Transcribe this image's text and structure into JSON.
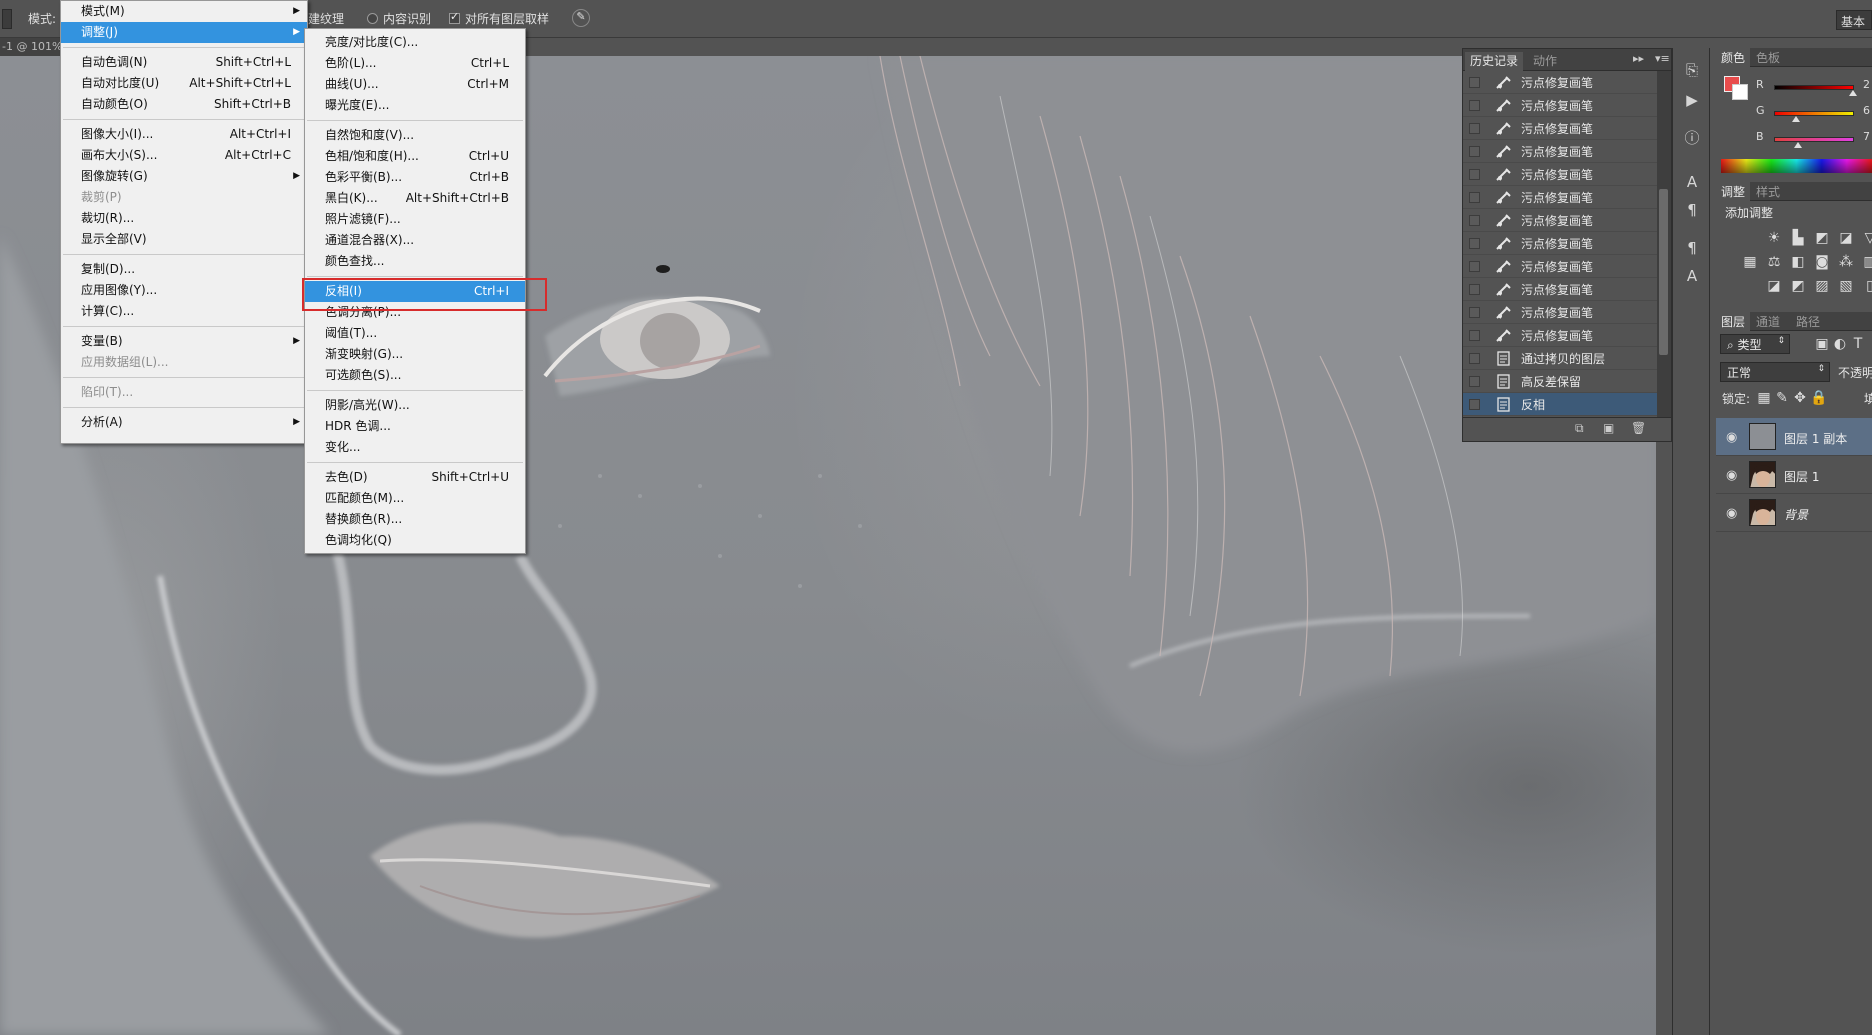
{
  "options_bar": {
    "mode_label": "模式:",
    "option_texture": "建纹理",
    "option_content_aware": "内容识别",
    "option_sample_all": "对所有图层取样",
    "doc_tab_fragment": "-1 @ 101%",
    "workspace_button": "基本"
  },
  "image_menu": {
    "items": [
      {
        "label": "模式(M)",
        "shortcut": "",
        "submenu": true
      },
      {
        "label": "调整(J)",
        "shortcut": "",
        "submenu": true,
        "highlighted": true
      },
      {
        "label": "自动色调(N)",
        "shortcut": "Shift+Ctrl+L"
      },
      {
        "label": "自动对比度(U)",
        "shortcut": "Alt+Shift+Ctrl+L"
      },
      {
        "label": "自动颜色(O)",
        "shortcut": "Shift+Ctrl+B"
      },
      {
        "label": "图像大小(I)...",
        "shortcut": "Alt+Ctrl+I"
      },
      {
        "label": "画布大小(S)...",
        "shortcut": "Alt+Ctrl+C"
      },
      {
        "label": "图像旋转(G)",
        "shortcut": "",
        "submenu": true
      },
      {
        "label": "裁剪(P)",
        "shortcut": "",
        "disabled": true
      },
      {
        "label": "裁切(R)...",
        "shortcut": ""
      },
      {
        "label": "显示全部(V)",
        "shortcut": ""
      },
      {
        "label": "复制(D)...",
        "shortcut": ""
      },
      {
        "label": "应用图像(Y)...",
        "shortcut": ""
      },
      {
        "label": "计算(C)...",
        "shortcut": ""
      },
      {
        "label": "变量(B)",
        "shortcut": "",
        "submenu": true
      },
      {
        "label": "应用数据组(L)...",
        "shortcut": "",
        "disabled": true
      },
      {
        "label": "陷印(T)...",
        "shortcut": "",
        "disabled": true
      },
      {
        "label": "分析(A)",
        "shortcut": "",
        "submenu": true
      }
    ]
  },
  "adjust_menu": {
    "items": [
      {
        "label": "亮度/对比度(C)...",
        "shortcut": ""
      },
      {
        "label": "色阶(L)...",
        "shortcut": "Ctrl+L"
      },
      {
        "label": "曲线(U)...",
        "shortcut": "Ctrl+M"
      },
      {
        "label": "曝光度(E)...",
        "shortcut": ""
      },
      {
        "label": "自然饱和度(V)...",
        "shortcut": ""
      },
      {
        "label": "色相/饱和度(H)...",
        "shortcut": "Ctrl+U"
      },
      {
        "label": "色彩平衡(B)...",
        "shortcut": "Ctrl+B"
      },
      {
        "label": "黑白(K)...",
        "shortcut": "Alt+Shift+Ctrl+B"
      },
      {
        "label": "照片滤镜(F)...",
        "shortcut": ""
      },
      {
        "label": "通道混合器(X)...",
        "shortcut": ""
      },
      {
        "label": "颜色查找...",
        "shortcut": ""
      },
      {
        "label": "反相(I)",
        "shortcut": "Ctrl+I",
        "highlighted": true
      },
      {
        "label": "色调分离(P)...",
        "shortcut": ""
      },
      {
        "label": "阈值(T)...",
        "shortcut": ""
      },
      {
        "label": "渐变映射(G)...",
        "shortcut": ""
      },
      {
        "label": "可选颜色(S)...",
        "shortcut": ""
      },
      {
        "label": "阴影/高光(W)...",
        "shortcut": ""
      },
      {
        "label": "HDR 色调...",
        "shortcut": ""
      },
      {
        "label": "变化...",
        "shortcut": ""
      },
      {
        "label": "去色(D)",
        "shortcut": "Shift+Ctrl+U"
      },
      {
        "label": "匹配颜色(M)...",
        "shortcut": ""
      },
      {
        "label": "替换颜色(R)...",
        "shortcut": ""
      },
      {
        "label": "色调均化(Q)",
        "shortcut": ""
      }
    ]
  },
  "history_panel": {
    "tab_history": "历史记录",
    "tab_actions": "动作",
    "rows": [
      {
        "label": "污点修复画笔",
        "icon": "healing-brush-icon"
      },
      {
        "label": "污点修复画笔",
        "icon": "healing-brush-icon"
      },
      {
        "label": "污点修复画笔",
        "icon": "healing-brush-icon"
      },
      {
        "label": "污点修复画笔",
        "icon": "healing-brush-icon"
      },
      {
        "label": "污点修复画笔",
        "icon": "healing-brush-icon"
      },
      {
        "label": "污点修复画笔",
        "icon": "healing-brush-icon"
      },
      {
        "label": "污点修复画笔",
        "icon": "healing-brush-icon"
      },
      {
        "label": "污点修复画笔",
        "icon": "healing-brush-icon"
      },
      {
        "label": "污点修复画笔",
        "icon": "healing-brush-icon"
      },
      {
        "label": "污点修复画笔",
        "icon": "healing-brush-icon"
      },
      {
        "label": "污点修复画笔",
        "icon": "healing-brush-icon"
      },
      {
        "label": "污点修复画笔",
        "icon": "healing-brush-icon"
      },
      {
        "label": "通过拷贝的图层",
        "icon": "document-icon"
      },
      {
        "label": "高反差保留",
        "icon": "document-icon"
      },
      {
        "label": "反相",
        "icon": "document-icon",
        "active": true
      }
    ]
  },
  "color_panel": {
    "tab_color": "颜色",
    "tab_swatches": "色板",
    "foreground_color": "#e84c4c",
    "r_label": "R",
    "g_label": "G",
    "b_label": "B",
    "r_value": "2",
    "g_value": "6",
    "b_value": "7"
  },
  "adjustments_panel": {
    "tab_adjust": "调整",
    "tab_styles": "样式",
    "add_adjustment": "添加调整"
  },
  "layers_panel": {
    "tab_layers": "图层",
    "tab_channels": "通道",
    "tab_paths": "路径",
    "filter_kind": "类型",
    "blend_mode": "正常",
    "opacity_label": "不透明",
    "lock_label": "锁定:",
    "fill_label": "填",
    "layers": [
      {
        "name": "图层 1 副本",
        "active": true,
        "thumb": "gray"
      },
      {
        "name": "图层 1",
        "active": false,
        "thumb": "portrait"
      },
      {
        "name": "背景",
        "active": false,
        "thumb": "portrait",
        "italic": true
      }
    ]
  }
}
